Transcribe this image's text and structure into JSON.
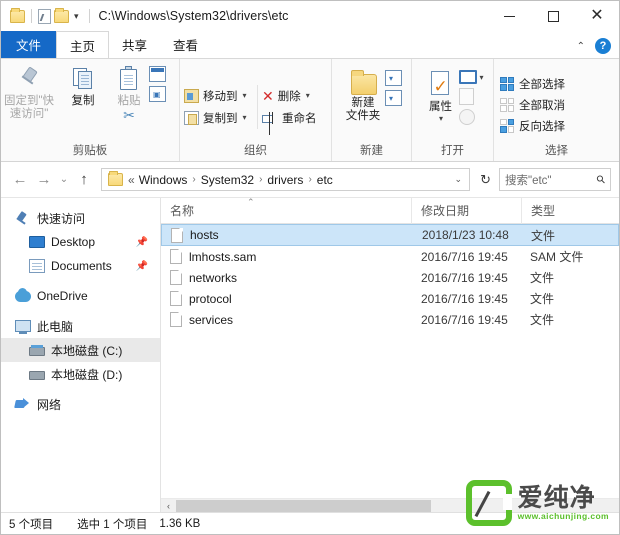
{
  "window": {
    "title_path": "C:\\Windows\\System32\\drivers\\etc",
    "minimize_label": "最小化",
    "maximize_label": "最大化",
    "close_label": "关闭"
  },
  "quick_access_toolbar": {
    "items": [
      {
        "name": "folder-icon",
        "label": ""
      },
      {
        "name": "properties-icon",
        "label": ""
      },
      {
        "name": "new-folder-icon",
        "label": ""
      }
    ],
    "dropdown": "▾"
  },
  "tabs": [
    {
      "id": "file",
      "label": "文件"
    },
    {
      "id": "home",
      "label": "主页"
    },
    {
      "id": "share",
      "label": "共享"
    },
    {
      "id": "view",
      "label": "查看"
    }
  ],
  "tab_right": {
    "collapse": "⌃",
    "help": "?"
  },
  "ribbon": {
    "groups": [
      {
        "id": "clipboard",
        "label": "剪贴板",
        "big_buttons": [
          {
            "name": "pin-to-quick-access",
            "label": "固定到\"快\n速访问\"",
            "line1": "固定到\"快",
            "line2": "速访问\"",
            "dim": true
          },
          {
            "name": "copy",
            "label": "复制",
            "dim": false
          },
          {
            "name": "paste",
            "label": "粘贴",
            "dim": true
          }
        ],
        "mini": [
          {
            "name": "copy-path",
            "label": ""
          },
          {
            "name": "paste-shortcut",
            "label": ""
          }
        ],
        "cut_label": "剪切"
      },
      {
        "id": "organize",
        "label": "组织",
        "rows": [
          {
            "name": "move-to",
            "label": "移动到",
            "caret": "▾"
          },
          {
            "name": "delete",
            "label": "删除",
            "caret": "▾"
          },
          {
            "name": "copy-to",
            "label": "复制到",
            "caret": "▾"
          },
          {
            "name": "rename",
            "label": "重命名",
            "caret": ""
          }
        ]
      },
      {
        "id": "new",
        "label": "新建",
        "big": {
          "name": "new-folder",
          "line1": "新建",
          "line2": "文件夹"
        },
        "mini": [
          {
            "name": "new-item",
            "caret": "▾"
          },
          {
            "name": "easy-access",
            "caret": "▾"
          }
        ]
      },
      {
        "id": "open",
        "label": "打开",
        "big": {
          "name": "properties",
          "label": "属性",
          "caret": "▾"
        },
        "mini": [
          {
            "name": "open-with",
            "caret": "▾"
          },
          {
            "name": "edit",
            "caret": ""
          },
          {
            "name": "history",
            "caret": ""
          }
        ]
      },
      {
        "id": "select",
        "label": "选择",
        "rows": [
          {
            "name": "select-all",
            "label": "全部选择"
          },
          {
            "name": "select-none",
            "label": "全部取消"
          },
          {
            "name": "invert-selection",
            "label": "反向选择"
          }
        ]
      }
    ]
  },
  "addressbar": {
    "back": "←",
    "forward": "→",
    "recent": "⌄",
    "up": "↑",
    "crumbs": [
      "«",
      "Windows",
      "System32",
      "drivers",
      "etc"
    ],
    "separator": "›",
    "dropdown": "⌄",
    "refresh": "↻",
    "search_value": "搜索\"etc\"",
    "search_icon": "search-icon"
  },
  "sidebar": {
    "items": [
      {
        "name": "quick-access",
        "label": "快速访问",
        "icon": "pin-icon",
        "indent": false,
        "selected": false,
        "pinned": false
      },
      {
        "name": "desktop",
        "label": "Desktop",
        "icon": "desktop-icon",
        "indent": true,
        "selected": false,
        "pinned": true
      },
      {
        "name": "documents",
        "label": "Documents",
        "icon": "documents-icon",
        "indent": true,
        "selected": false,
        "pinned": true
      },
      {
        "name": "onedrive",
        "label": "OneDrive",
        "icon": "cloud-icon",
        "indent": false,
        "selected": false,
        "pinned": false
      },
      {
        "name": "this-pc",
        "label": "此电脑",
        "icon": "pc-icon",
        "indent": false,
        "selected": false,
        "pinned": false
      },
      {
        "name": "local-disk-c",
        "label": "本地磁盘 (C:)",
        "icon": "drive-icon",
        "indent": true,
        "selected": true,
        "pinned": false
      },
      {
        "name": "local-disk-d",
        "label": "本地磁盘 (D:)",
        "icon": "drive-icon",
        "indent": true,
        "selected": false,
        "pinned": false
      },
      {
        "name": "network",
        "label": "网络",
        "icon": "network-icon",
        "indent": false,
        "selected": false,
        "pinned": false
      }
    ]
  },
  "filelist": {
    "columns": [
      {
        "id": "name",
        "label": "名称",
        "sorted": true,
        "sort_glyph": "⌃"
      },
      {
        "id": "date",
        "label": "修改日期"
      },
      {
        "id": "type",
        "label": "类型"
      }
    ],
    "rows": [
      {
        "name": "hosts",
        "date": "2018/1/23 10:48",
        "type": "文件",
        "selected": true
      },
      {
        "name": "lmhosts.sam",
        "date": "2016/7/16 19:45",
        "type": "SAM 文件",
        "selected": false
      },
      {
        "name": "networks",
        "date": "2016/7/16 19:45",
        "type": "文件",
        "selected": false
      },
      {
        "name": "protocol",
        "date": "2016/7/16 19:45",
        "type": "文件",
        "selected": false
      },
      {
        "name": "services",
        "date": "2016/7/16 19:45",
        "type": "文件",
        "selected": false
      }
    ]
  },
  "scrollbar": {
    "left_arrow": "‹",
    "right_arrow": "›"
  },
  "statusbar": {
    "item_count": "5 个项目",
    "selection": "选中 1 个项目",
    "size": "1.36 KB"
  },
  "watermark": {
    "brand_cn": "爱纯净",
    "url": "www.aichunjing.com",
    "accent_color": "#5cc02c"
  }
}
